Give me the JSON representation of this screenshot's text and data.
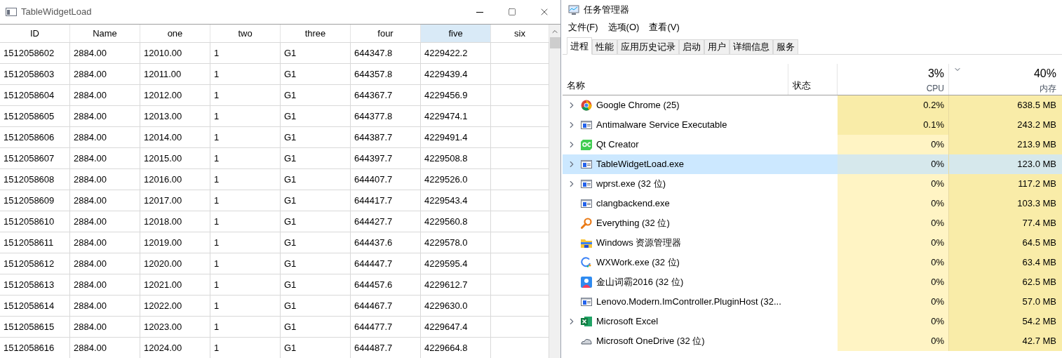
{
  "table_window": {
    "title": "TableWidgetLoad",
    "columns": [
      {
        "label": "ID",
        "selected": false
      },
      {
        "label": "Name",
        "selected": false
      },
      {
        "label": "one",
        "selected": false
      },
      {
        "label": "two",
        "selected": false
      },
      {
        "label": "three",
        "selected": false
      },
      {
        "label": "four",
        "selected": false
      },
      {
        "label": "five",
        "selected": true
      },
      {
        "label": "six",
        "selected": false
      }
    ],
    "rows": [
      [
        "1512058602",
        "2884.00",
        "12010.00",
        "1",
        "G1",
        "644347.8",
        "4229422.2"
      ],
      [
        "1512058603",
        "2884.00",
        "12011.00",
        "1",
        "G1",
        "644357.8",
        "4229439.4"
      ],
      [
        "1512058604",
        "2884.00",
        "12012.00",
        "1",
        "G1",
        "644367.7",
        "4229456.9"
      ],
      [
        "1512058605",
        "2884.00",
        "12013.00",
        "1",
        "G1",
        "644377.8",
        "4229474.1"
      ],
      [
        "1512058606",
        "2884.00",
        "12014.00",
        "1",
        "G1",
        "644387.7",
        "4229491.4"
      ],
      [
        "1512058607",
        "2884.00",
        "12015.00",
        "1",
        "G1",
        "644397.7",
        "4229508.8"
      ],
      [
        "1512058608",
        "2884.00",
        "12016.00",
        "1",
        "G1",
        "644407.7",
        "4229526.0"
      ],
      [
        "1512058609",
        "2884.00",
        "12017.00",
        "1",
        "G1",
        "644417.7",
        "4229543.4"
      ],
      [
        "1512058610",
        "2884.00",
        "12018.00",
        "1",
        "G1",
        "644427.7",
        "4229560.8"
      ],
      [
        "1512058611",
        "2884.00",
        "12019.00",
        "1",
        "G1",
        "644437.6",
        "4229578.0"
      ],
      [
        "1512058612",
        "2884.00",
        "12020.00",
        "1",
        "G1",
        "644447.7",
        "4229595.4"
      ],
      [
        "1512058613",
        "2884.00",
        "12021.00",
        "1",
        "G1",
        "644457.6",
        "4229612.7"
      ],
      [
        "1512058614",
        "2884.00",
        "12022.00",
        "1",
        "G1",
        "644467.7",
        "4229630.0"
      ],
      [
        "1512058615",
        "2884.00",
        "12023.00",
        "1",
        "G1",
        "644477.7",
        "4229647.4"
      ],
      [
        "1512058616",
        "2884.00",
        "12024.00",
        "1",
        "G1",
        "644487.7",
        "4229664.8"
      ]
    ]
  },
  "task_manager": {
    "title": "任务管理器",
    "menu": [
      "文件(F)",
      "选项(O)",
      "查看(V)"
    ],
    "tabs": [
      {
        "label": "进程",
        "selected": true
      },
      {
        "label": "性能",
        "selected": false
      },
      {
        "label": "应用历史记录",
        "selected": false
      },
      {
        "label": "启动",
        "selected": false
      },
      {
        "label": "用户",
        "selected": false
      },
      {
        "label": "详细信息",
        "selected": false
      },
      {
        "label": "服务",
        "selected": false
      }
    ],
    "columns": {
      "name": "名称",
      "status": "状态",
      "cpu_total": "3%",
      "cpu": "CPU",
      "memory_total": "40%",
      "memory": "内存"
    },
    "processes": [
      {
        "name": "Google Chrome (25)",
        "kind": "chrome",
        "expandable": true,
        "selected": false,
        "cpu": "0.2%",
        "memory": "638.5 MB",
        "cpu_busy": true
      },
      {
        "name": "Antimalware Service Executable",
        "kind": "window",
        "expandable": true,
        "selected": false,
        "cpu": "0.1%",
        "memory": "243.2 MB",
        "cpu_busy": true
      },
      {
        "name": "Qt Creator",
        "kind": "qt",
        "expandable": true,
        "selected": false,
        "cpu": "0%",
        "memory": "213.9 MB",
        "cpu_busy": false
      },
      {
        "name": "TableWidgetLoad.exe",
        "kind": "window",
        "expandable": true,
        "selected": true,
        "cpu": "0%",
        "memory": "123.0 MB",
        "cpu_busy": false
      },
      {
        "name": "wprst.exe (32 位)",
        "kind": "window",
        "expandable": true,
        "selected": false,
        "cpu": "0%",
        "memory": "117.2 MB",
        "cpu_busy": false
      },
      {
        "name": "clangbackend.exe",
        "kind": "window",
        "expandable": false,
        "selected": false,
        "cpu": "0%",
        "memory": "103.3 MB",
        "cpu_busy": false
      },
      {
        "name": "Everything (32 位)",
        "kind": "search",
        "expandable": false,
        "selected": false,
        "cpu": "0%",
        "memory": "77.4 MB",
        "cpu_busy": false
      },
      {
        "name": "Windows 资源管理器",
        "kind": "folder",
        "expandable": false,
        "selected": false,
        "cpu": "0%",
        "memory": "64.5 MB",
        "cpu_busy": false
      },
      {
        "name": "WXWork.exe (32 位)",
        "kind": "ring",
        "expandable": false,
        "selected": false,
        "cpu": "0%",
        "memory": "63.4 MB",
        "cpu_busy": false
      },
      {
        "name": "金山词霸2016 (32 位)",
        "kind": "person",
        "expandable": false,
        "selected": false,
        "cpu": "0%",
        "memory": "62.5 MB",
        "cpu_busy": false
      },
      {
        "name": "Lenovo.Modern.ImController.PluginHost (32...",
        "kind": "window",
        "expandable": false,
        "selected": false,
        "cpu": "0%",
        "memory": "57.0 MB",
        "cpu_busy": false
      },
      {
        "name": "Microsoft Excel",
        "kind": "excel",
        "expandable": true,
        "selected": false,
        "cpu": "0%",
        "memory": "54.2 MB",
        "cpu_busy": false
      },
      {
        "name": "Microsoft OneDrive (32 位)",
        "kind": "cloud",
        "expandable": false,
        "selected": false,
        "cpu": "0%",
        "memory": "42.7 MB",
        "cpu_busy": false
      }
    ]
  }
}
